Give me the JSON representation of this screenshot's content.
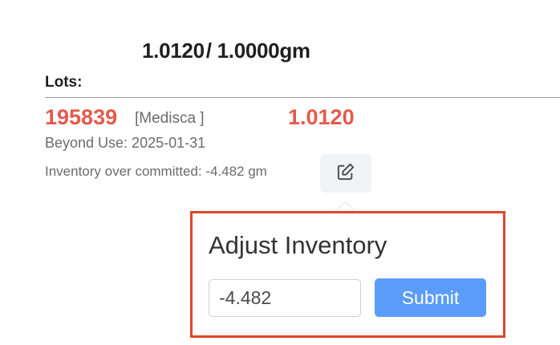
{
  "summary": {
    "committed": "1.0120",
    "separator": "/",
    "total": "1.0000gm"
  },
  "lots": {
    "label": "Lots:",
    "items": [
      {
        "number": "195839",
        "supplier": "[Medisca ]",
        "quantity": "1.0120",
        "beyond_use": "Beyond Use: 2025-01-31",
        "overcommit_note": "Inventory over committed: -4.482 gm"
      }
    ]
  },
  "icons": {
    "edit": "edit-icon"
  },
  "colors": {
    "accent_red": "#e55a4a",
    "highlight_border": "#e0452a",
    "submit_blue": "#5a9cf8"
  },
  "adjust_popover": {
    "title": "Adjust Inventory",
    "input_value": "-4.482",
    "submit_label": "Submit"
  }
}
